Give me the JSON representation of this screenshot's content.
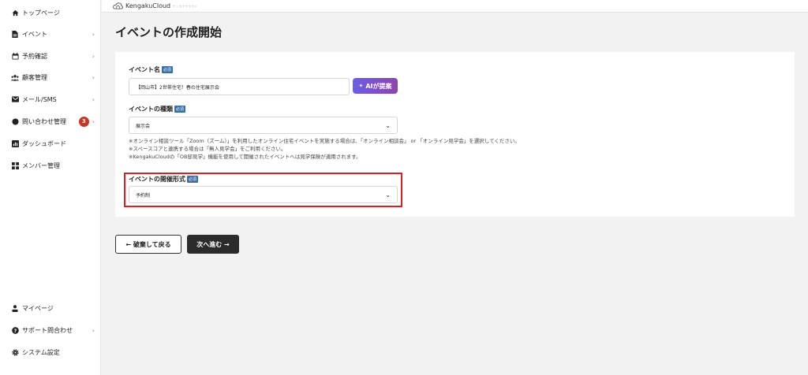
{
  "header": {
    "logo_text": "KengakuCloud",
    "logo_sub": "ケンガククラウド"
  },
  "sidebar": {
    "items": [
      {
        "label": "トップページ",
        "icon": "home-icon"
      },
      {
        "label": "イベント",
        "icon": "document-icon",
        "chevron": "›"
      },
      {
        "label": "予約確認",
        "icon": "calendar-icon",
        "chevron": "›"
      },
      {
        "label": "顧客管理",
        "icon": "users-icon",
        "chevron": "›"
      },
      {
        "label": "メール/SMS",
        "icon": "mail-icon",
        "chevron": "›"
      },
      {
        "label": "問い合わせ管理",
        "icon": "chat-icon",
        "badge": "3",
        "chevron": "›"
      },
      {
        "label": "ダッシュボード",
        "icon": "chart-icon"
      },
      {
        "label": "メンバー管理",
        "icon": "grid-icon"
      }
    ],
    "bottom_items": [
      {
        "label": "マイページ",
        "icon": "person-icon"
      },
      {
        "label": "サポート問合わせ",
        "icon": "help-icon",
        "chevron": "›"
      },
      {
        "label": "システム設定",
        "icon": "gear-icon"
      }
    ]
  },
  "page": {
    "title": "イベントの作成開始"
  },
  "form": {
    "required_label": "必須",
    "event_name": {
      "label": "イベント名",
      "value": "【岡山市】2世帯住宅！春の住宅展示会"
    },
    "ai_button": "AIが提案",
    "event_type": {
      "label": "イベントの種類",
      "value": "展示会"
    },
    "notes": [
      "※オンライン相談ツール「Zoom（ズーム）」を利用したオンライン住宅イベントを実施する場合は、「オンライン相談会」 or 「オンライン見学会」を選択してください。",
      "※スペースコアと連携する場合は「無人見学会」をご利用ください。",
      "※KengakuCloudの「OB邸見学」機能を使用して開催されたイベントへは見学保険が適用されます。"
    ],
    "event_format": {
      "label": "イベントの開催形式",
      "value": "予約制"
    }
  },
  "actions": {
    "back": "← 破棄して戻る",
    "next": "次へ進む →"
  },
  "colors": {
    "highlight": "#e01e1e",
    "required_badge": "#3a6ea5",
    "ai_gradient_start": "#6c5ce7",
    "next_button": "#2b2b2b"
  }
}
